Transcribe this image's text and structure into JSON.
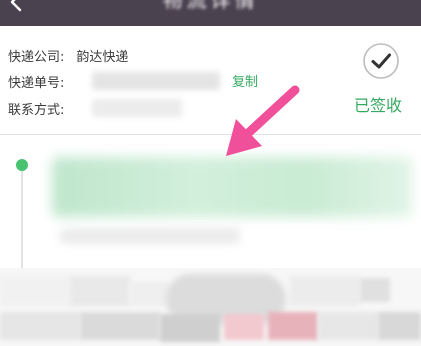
{
  "titlebar": {
    "title": "物流详情",
    "back_icon": "back-arrow-icon",
    "background": "#4b4250"
  },
  "info": {
    "company_label": "快递公司:",
    "company_value": "韵达快递",
    "number_label": "快递单号:",
    "copy_label": "复制",
    "contact_label": "联系方式:"
  },
  "status": {
    "icon": "check-circle-icon",
    "label": "已签收",
    "color": "#36a961"
  },
  "timeline": {
    "dot_color": "#47c26e",
    "active_fill": "#c9ebd3"
  },
  "annotation": {
    "arrow_color": "#f04f9a",
    "icon": "pointer-arrow-icon"
  }
}
